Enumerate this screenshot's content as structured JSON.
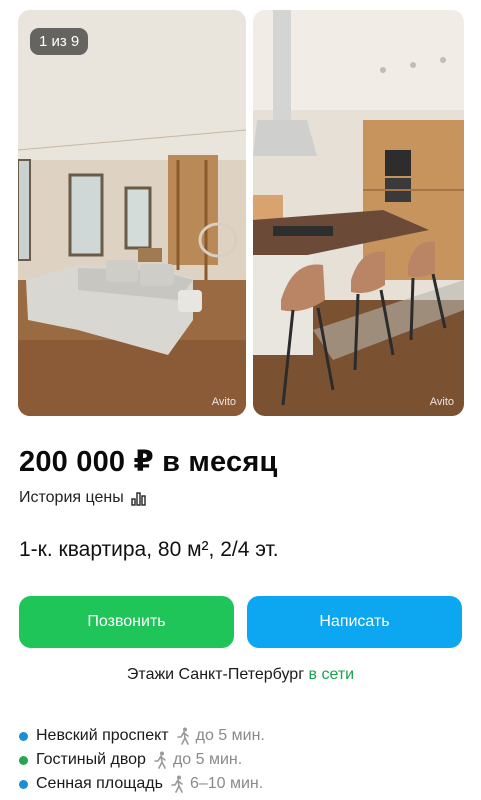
{
  "gallery": {
    "counter": "1 из 9",
    "watermark": "Avito"
  },
  "listing": {
    "price": "200 000 ₽ в месяц",
    "price_history_label": "История цены",
    "title": "1-к. квартира, 80 м², 2/4 эт."
  },
  "actions": {
    "call_label": "Позвонить",
    "write_label": "Написать",
    "call_color": "#1fc559",
    "write_color": "#0ca6f1"
  },
  "seller": {
    "name": "Этажи Санкт-Петербург",
    "status": "в сети"
  },
  "metro": [
    {
      "station": "Невский проспект",
      "time": "до 5 мин.",
      "color": "#1a8fd6"
    },
    {
      "station": "Гостиный двор",
      "time": "до 5 мин.",
      "color": "#26a650"
    },
    {
      "station": "Сенная площадь",
      "time": "6–10 мин.",
      "color": "#1a8fd6"
    }
  ]
}
